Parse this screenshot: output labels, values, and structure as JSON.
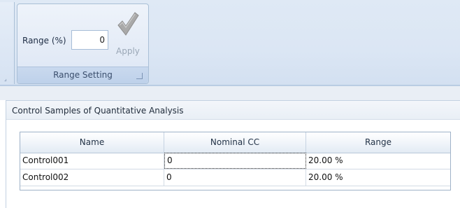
{
  "ribbon": {
    "range_group": {
      "label": "Range (%)",
      "value": "0",
      "apply_label": "Apply",
      "title": "Range Setting"
    }
  },
  "panel": {
    "title": "Control Samples of Quantitative Analysis"
  },
  "table": {
    "columns": [
      "Name",
      "Nominal CC",
      "Range"
    ],
    "rows": [
      [
        "Control001",
        "0",
        "20.00 %"
      ],
      [
        "Control002",
        "0",
        "20.00 %"
      ]
    ]
  },
  "icons": {
    "apply": "checkmark-icon",
    "launcher": "dialog-launcher-icon"
  },
  "colors": {
    "ribbon_bg": "#dbe6f4",
    "group_border": "#a9bfd6",
    "apply_disabled": "#9aa7b6",
    "checkmark_gray": "#a9a9a9"
  }
}
